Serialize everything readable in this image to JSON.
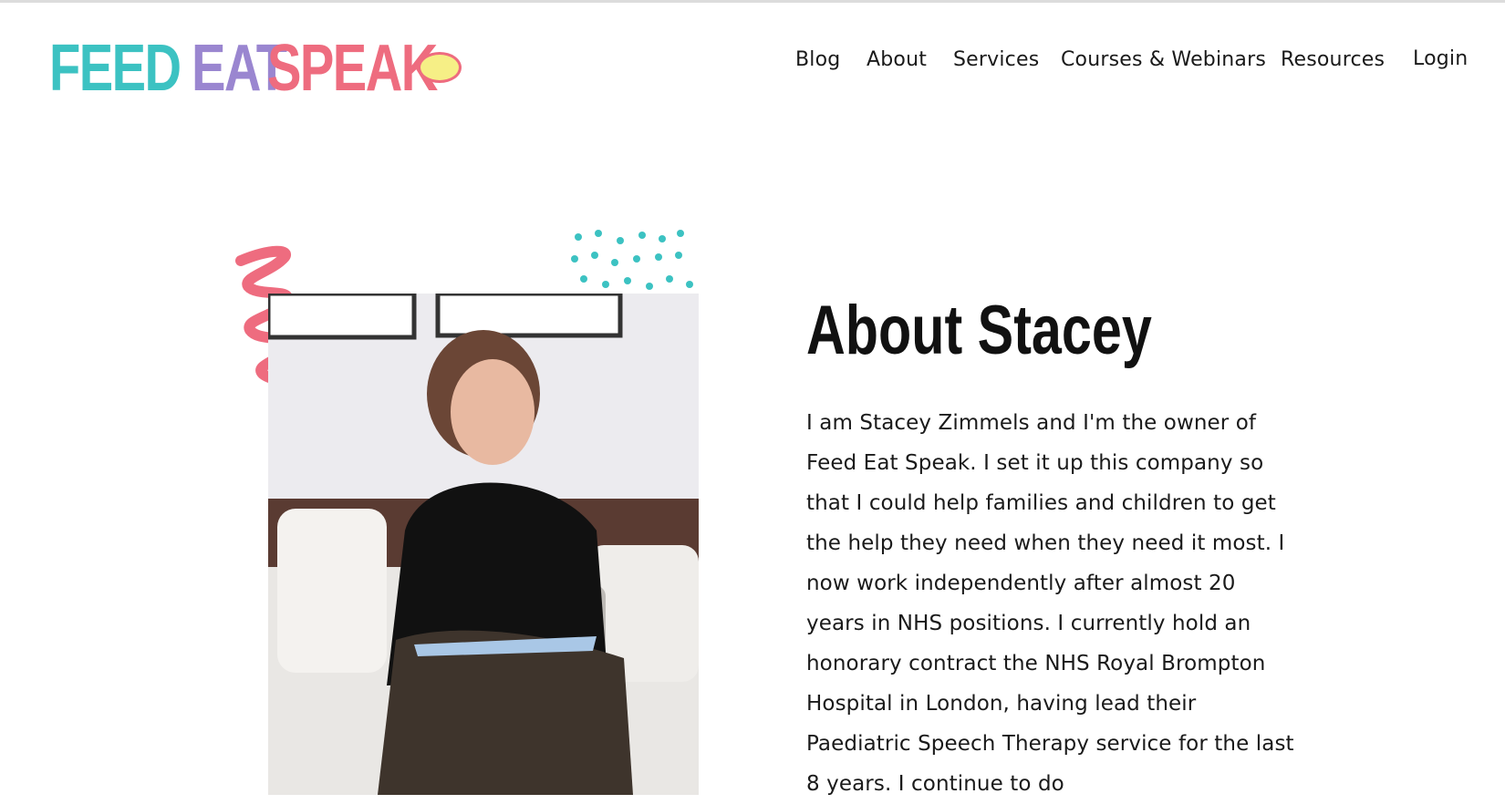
{
  "logo": {
    "feed": "FEED",
    "eat": "EAT",
    "speak": "SPEAK",
    "colors": {
      "feed": "#3cc2c2",
      "eat": "#9a86d0",
      "speak": "#ee6c7f",
      "bubble": "#f6ef86"
    }
  },
  "nav": {
    "items": [
      {
        "label": "Blog"
      },
      {
        "label": "About"
      },
      {
        "label": "Services"
      },
      {
        "label": "Courses & Webinars"
      },
      {
        "label": "Resources"
      },
      {
        "label": "Login"
      }
    ]
  },
  "about": {
    "title": "About Stacey",
    "body": "I am Stacey Zimmels and I'm the owner of Feed Eat Speak. I set it up this company so that I could help families and children to get the help they need when they need it most. I now work independently after almost 20 years in NHS positions. I currently hold an honorary contract the NHS Royal Brompton Hospital in London, having lead their Paediatric Speech Therapy service for the last 8 years. I continue to do",
    "photo_icon": "portrait-photo",
    "decorations": [
      "pink-squiggle-icon",
      "teal-dots-pattern"
    ]
  }
}
